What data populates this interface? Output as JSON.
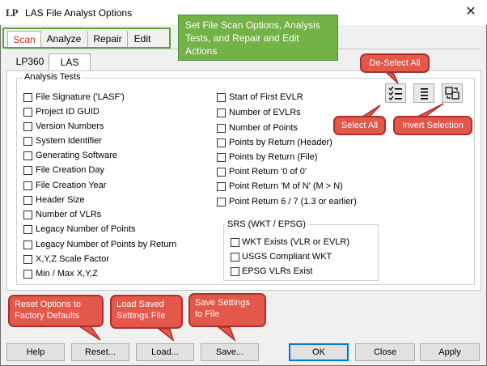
{
  "window": {
    "title": "LAS File Analyst Options",
    "logo": "LP",
    "close_glyph": "✕"
  },
  "tabs": [
    {
      "label": "Scan",
      "color": "#e0281e"
    },
    {
      "label": "Analyze"
    },
    {
      "label": "Repair"
    },
    {
      "label": "Edit"
    }
  ],
  "subtabs": [
    {
      "label": "LP360"
    },
    {
      "label": "LAS"
    }
  ],
  "analysis": {
    "title": "Analysis Tests",
    "left_items": [
      "File Signature ('LASF')",
      "Project ID GUID",
      "Version Numbers",
      "System Identifier",
      "Generating Software",
      "File Creation Day",
      "File Creation Year",
      "Header Size",
      "Number of VLRs",
      "Legacy Number of Points",
      "Legacy Number of Points by Return",
      "X,Y,Z Scale Factor",
      "Min / Max X,Y,Z"
    ],
    "right_items": [
      "Start of First EVLR",
      "Number of EVLRs",
      "Number of Points",
      "Points by Return (Header)",
      "Points by Return (File)",
      "Point Return '0 of 0'",
      "Point Return 'M of N' (M > N)",
      "Point Return 6 / 7 (1.3 or earlier)"
    ]
  },
  "srs": {
    "title": "SRS (WKT / EPSG)",
    "items": [
      "WKT Exists (VLR or EVLR)",
      "USGS Compliant WKT",
      "EPSG VLRs Exist"
    ]
  },
  "icons": [
    "select-all-icon",
    "deselect-all-icon",
    "invert-selection-icon"
  ],
  "buttons": {
    "help": "Help",
    "reset": "Reset...",
    "load": "Load...",
    "save": "Save...",
    "ok": "OK",
    "close": "Close",
    "apply": "Apply"
  },
  "callouts": {
    "header_note": "Set File Scan Options, Analysis Tests, and Repair and Edit Actions",
    "deselect_all": "De-Select All",
    "select_all": "Select All",
    "invert_selection": "Invert Selection",
    "reset_note": "Reset Options to Factory Defaults",
    "load_note": "Load Saved Settings File",
    "save_note": "Save Settings to File"
  },
  "colors": {
    "callout": "#e4574b",
    "note": "#73b246",
    "highlight_border": "#58a63a"
  }
}
